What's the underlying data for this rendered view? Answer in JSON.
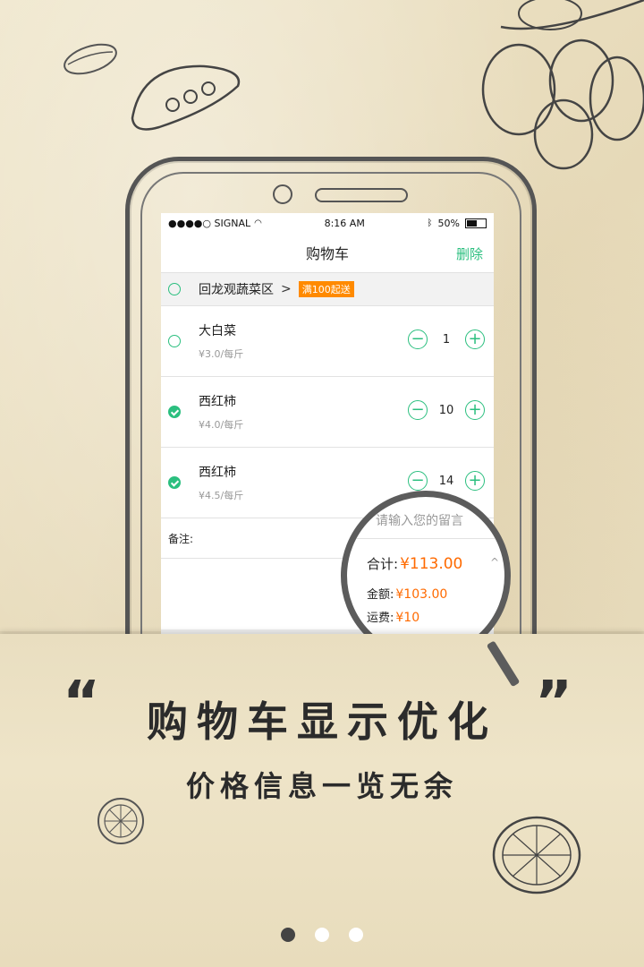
{
  "status_bar": {
    "carrier": "●●●●○ SIGNAL",
    "time": "8:16 AM",
    "battery": "50%",
    "battery_level": 0.5
  },
  "nav": {
    "title": "购物车",
    "action": "删除"
  },
  "store": {
    "name": "回龙观蔬菜区",
    "chevron": ">",
    "promo": "满100起送",
    "selected": false
  },
  "items": [
    {
      "name": "大白菜",
      "price": "¥3.0/每斤",
      "qty": "1",
      "selected": false
    },
    {
      "name": "西红柿",
      "price": "¥4.0/每斤",
      "qty": "10",
      "selected": true
    },
    {
      "name": "西红柿",
      "price": "¥4.5/每斤",
      "qty": "14",
      "selected": true
    }
  ],
  "stepper": {
    "minus": "−",
    "plus": "+"
  },
  "remark": {
    "label": "备注:",
    "placeholder": "请输入您的留言"
  },
  "summary": {
    "total_label": "合计:",
    "total_value": "¥113.00",
    "caret": "^",
    "amount_label": "金额:",
    "amount_value": "¥103.00",
    "shipping_label": "运费:",
    "shipping_value": "¥10"
  },
  "headline": {
    "open_quote": "“",
    "title": "购物车显示优化",
    "close_quote": "”",
    "subtitle": "价格信息一览无余"
  },
  "pager": {
    "count": 3,
    "active": 0
  },
  "colors": {
    "accent": "#2bbf7f",
    "price": "#ff6a00",
    "promo": "#ff8a00"
  }
}
